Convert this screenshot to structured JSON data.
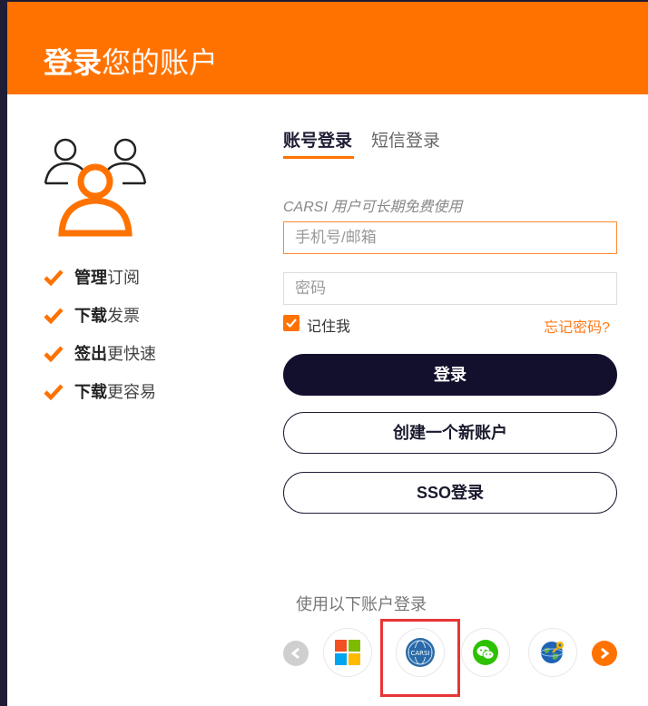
{
  "header": {
    "title_bold": "登录",
    "title_rest": "您的账户",
    "background": "#ff7200"
  },
  "features": [
    {
      "bold": "管理",
      "normal": "订阅"
    },
    {
      "bold": "下载",
      "normal": "发票"
    },
    {
      "bold": "签出",
      "normal": "更快速"
    },
    {
      "bold": "下载",
      "normal": "更容易"
    }
  ],
  "tabs": {
    "account": "账号登录",
    "sms": "短信登录"
  },
  "hint": "CARSI 用户可长期免费使用",
  "form": {
    "phone_placeholder": "手机号/邮箱",
    "password_placeholder": "密码",
    "remember_label": "记住我",
    "remember_checked": true,
    "forgot_label": "忘记密码?"
  },
  "buttons": {
    "login": "登录",
    "create": "创建一个新账户",
    "sso": "SSO登录"
  },
  "other_login": {
    "label": "使用以下账户登录",
    "providers": [
      {
        "name": "microsoft",
        "icon": "microsoft-icon"
      },
      {
        "name": "carsi",
        "icon": "carsi-icon",
        "text": "CARSI"
      },
      {
        "name": "wechat",
        "icon": "wechat-icon"
      },
      {
        "name": "globe",
        "icon": "globe-key-icon"
      }
    ]
  },
  "colors": {
    "accent": "#ff7200",
    "dark": "#13102e",
    "highlight": "#e83535"
  }
}
